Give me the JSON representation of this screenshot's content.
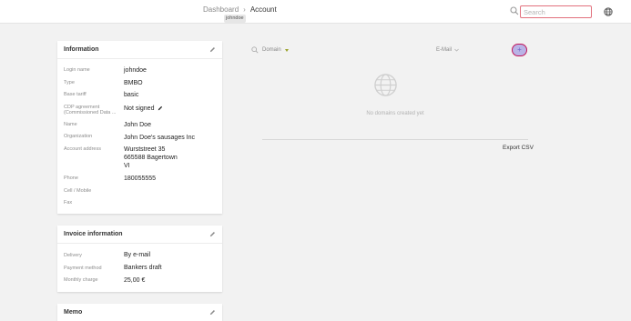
{
  "breadcrumb": {
    "parent": "Dashboard",
    "separator": "›",
    "current": "Account",
    "user_chip": "johndoe"
  },
  "topbar": {
    "search_placeholder": "Search"
  },
  "information": {
    "title": "Information",
    "login_name_label": "Login name",
    "login_name": "johndoe",
    "type_label": "Type",
    "type": "BMBO",
    "base_tariff_label": "Base tariff",
    "base_tariff": "basic",
    "cdp_label_1": "CDP agreement",
    "cdp_label_2": "(Commissioned Data ...",
    "cdp": "Not signed",
    "name_label": "Name",
    "name": "John Doe",
    "organization_label": "Organization",
    "organization": "John Doe's sausages Inc",
    "address_label": "Account address",
    "address_line1": "Wurststreet 35",
    "address_line2": "665588 Bagertown",
    "address_line3": "VI",
    "phone_label": "Phone",
    "phone": "180055555",
    "cell_label": "Cell / Mobile",
    "fax_label": "Fax"
  },
  "invoice": {
    "title": "Invoice information",
    "delivery_label": "Delivery",
    "delivery": "By e-mail",
    "payment_label": "Payment method",
    "payment": "Bankers draft",
    "charge_label": "Monthly charge",
    "charge": "25,00 €"
  },
  "memo": {
    "title": "Memo"
  },
  "domains": {
    "domain_filter": "Domain",
    "email_filter": "E-Mail",
    "add_label": "+",
    "empty_text": "No domains created yet",
    "export_label": "Export CSV"
  },
  "colors": {
    "accent_filter": "#9aa22a",
    "add_button_border": "#c2165a",
    "add_button_fill": "#b9b3e6",
    "search_border": "#e2707d"
  },
  "icons": [
    "search-icon",
    "globe-icon",
    "edit-icon",
    "pencil-icon",
    "chevron-down-icon"
  ]
}
